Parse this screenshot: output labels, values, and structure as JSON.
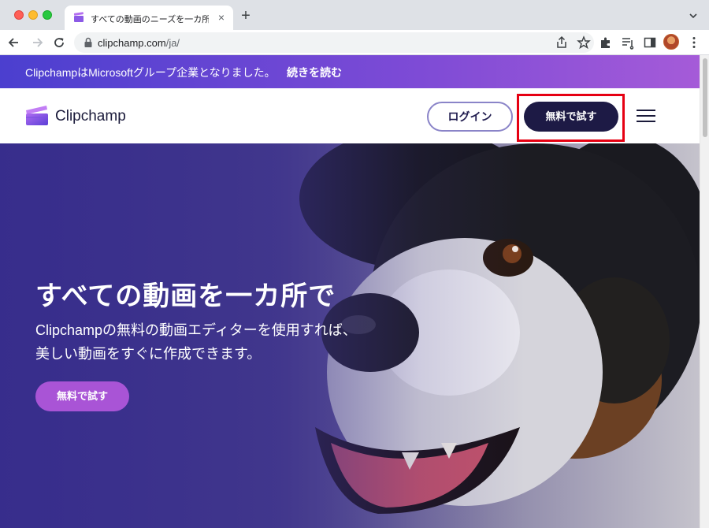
{
  "browser": {
    "tab_title": "すべての動画のニーズを一カ所で",
    "tab_close": "×",
    "new_tab": "+",
    "url_host": "clipchamp.com",
    "url_path": "/ja/"
  },
  "banner": {
    "text": "ClipchampはMicrosoftグループ企業となりました。",
    "link": "続きを読む"
  },
  "header": {
    "logo_text": "Clipchamp",
    "login_label": "ログイン",
    "trial_label": "無料で試す"
  },
  "hero": {
    "title": "すべての動画を一カ所で",
    "description": "Clipchampの無料の動画エディターを使用すれば、美しい動画をすぐに作成できます。",
    "cta_label": "無料で試す"
  },
  "colors": {
    "banner_start": "#4b3fcf",
    "banner_end": "#a55bd8",
    "trial_button": "#1d1a45",
    "hero_button": "#a954d6",
    "highlight": "#e60012"
  }
}
